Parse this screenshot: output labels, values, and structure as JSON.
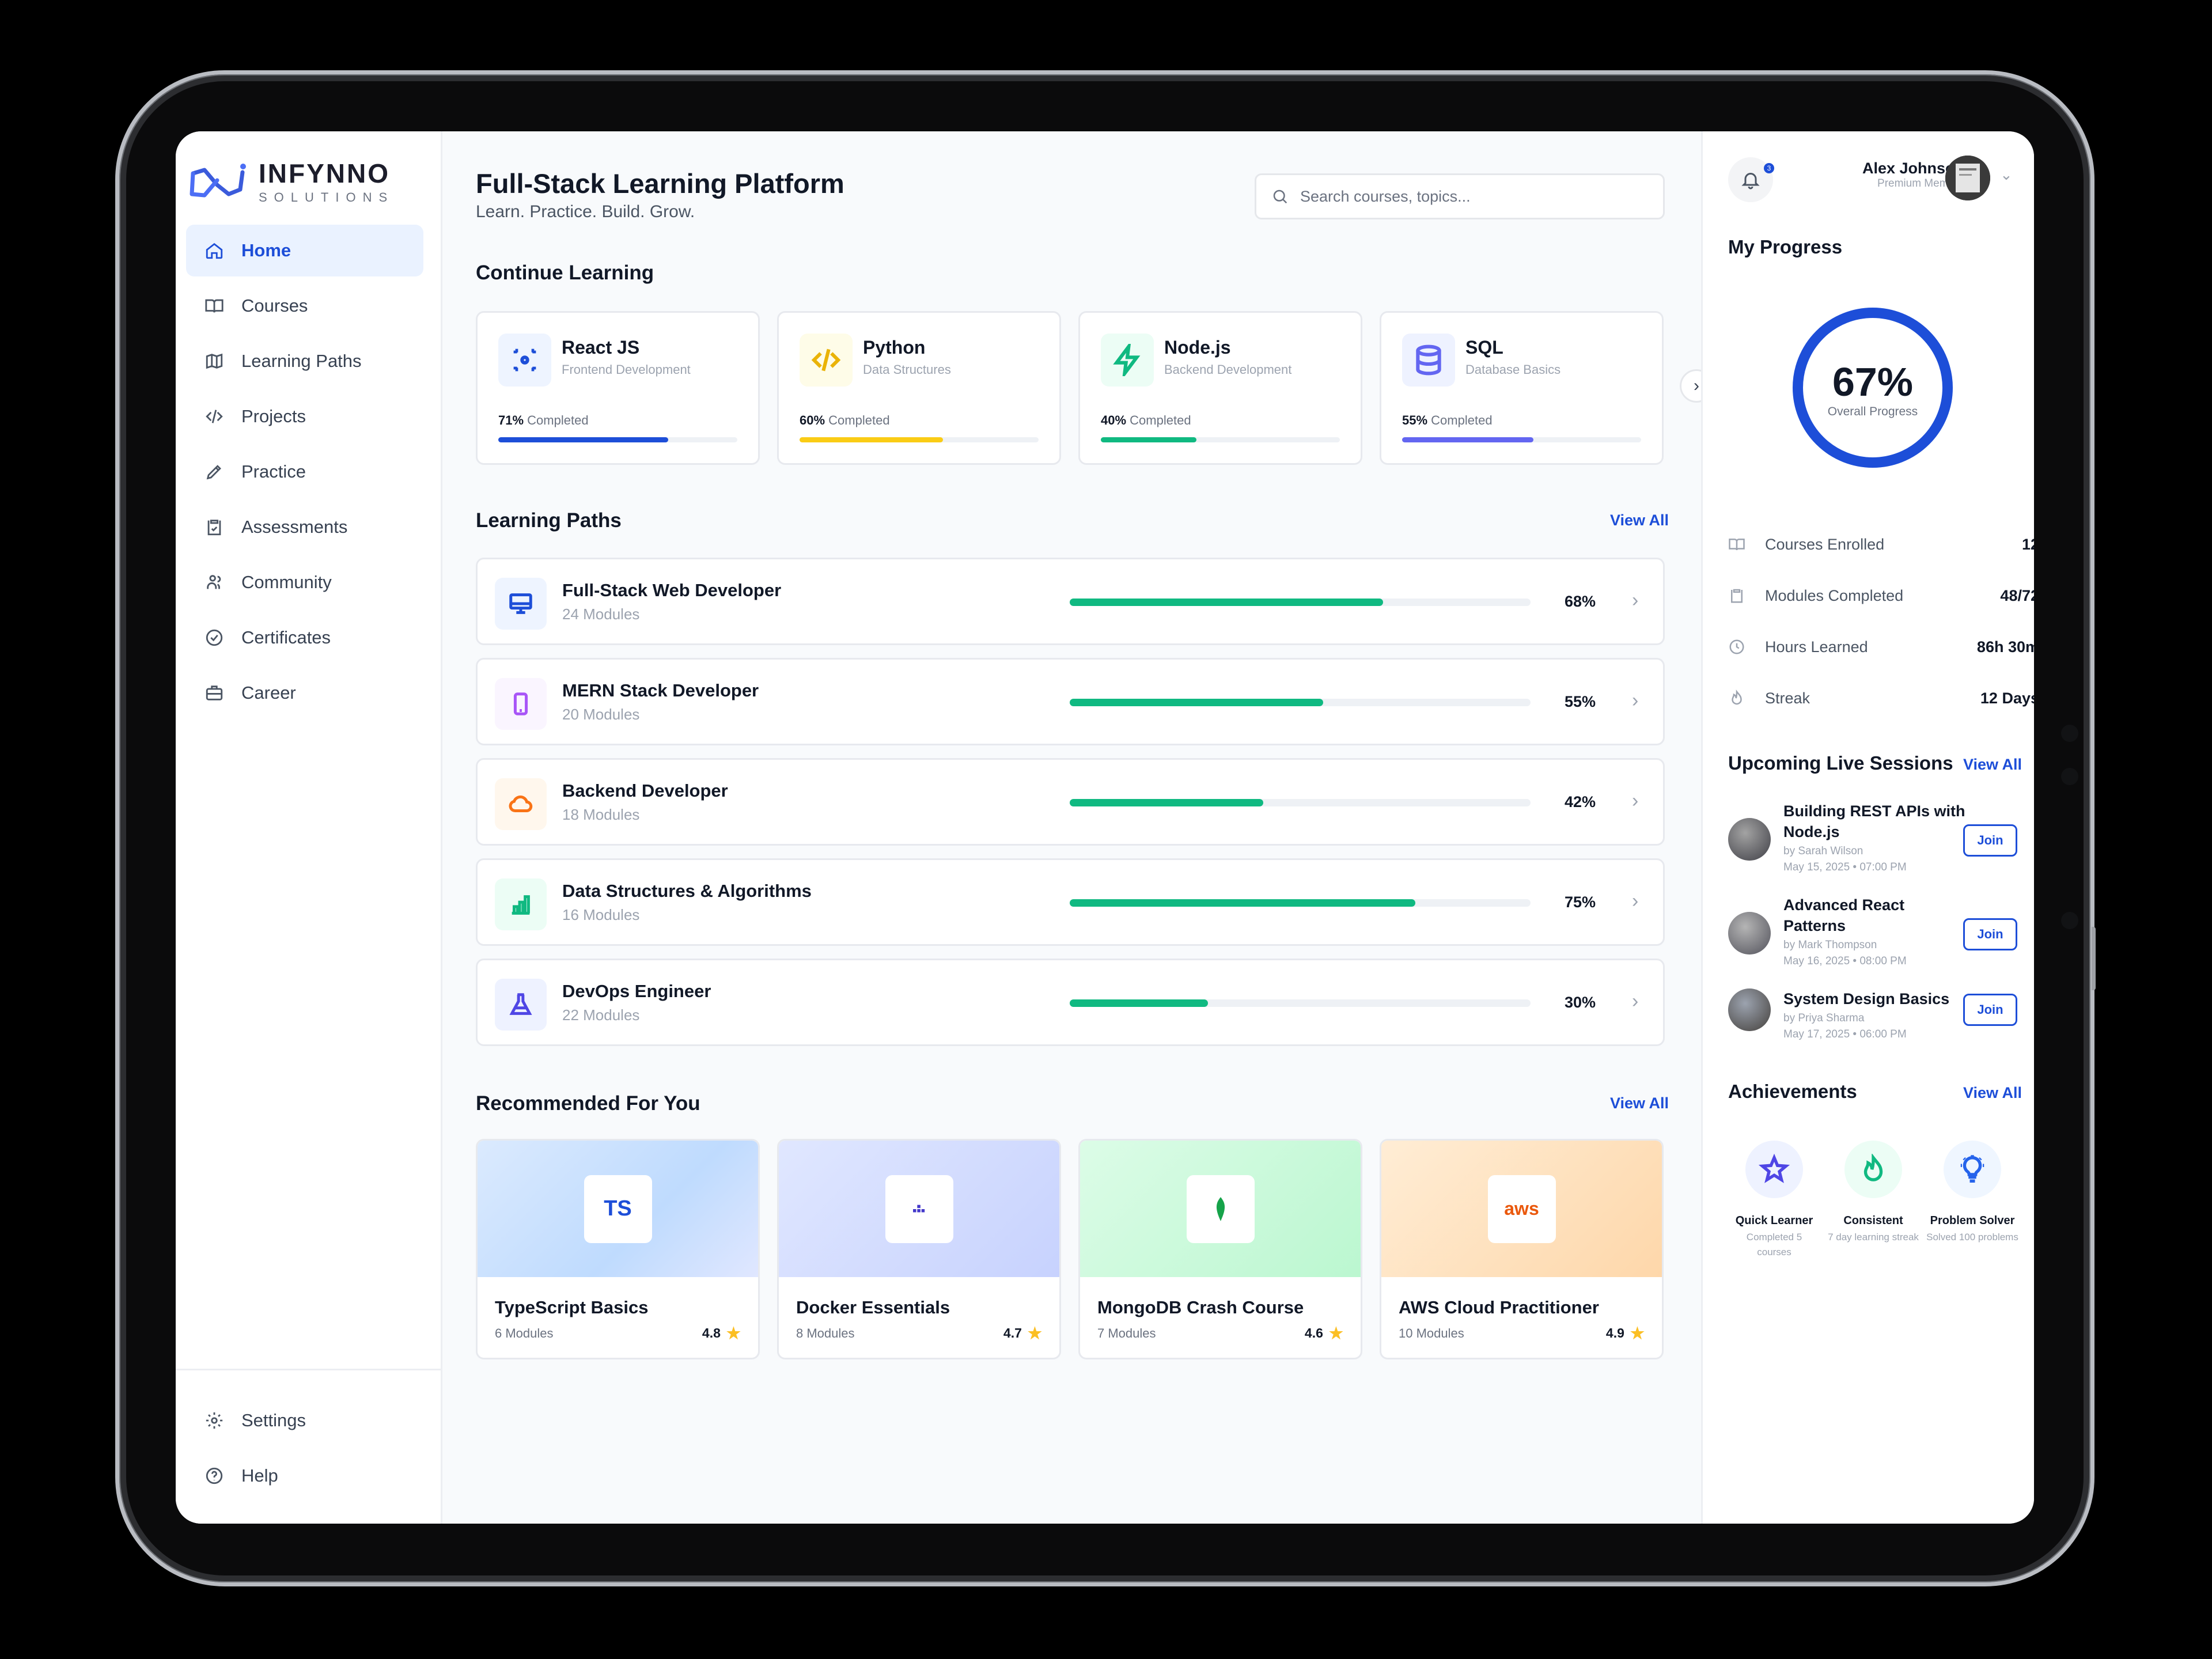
{
  "brand": {
    "name": "INFYNNO",
    "sub": "SOLUTIONS"
  },
  "nav": [
    {
      "label": "Home",
      "icon": "home-icon",
      "active": true
    },
    {
      "label": "Courses",
      "icon": "book-icon"
    },
    {
      "label": "Learning Paths",
      "icon": "map-icon"
    },
    {
      "label": "Projects",
      "icon": "code-icon"
    },
    {
      "label": "Practice",
      "icon": "pencil-icon"
    },
    {
      "label": "Assessments",
      "icon": "clipboard-icon"
    },
    {
      "label": "Community",
      "icon": "community-icon"
    },
    {
      "label": "Certificates",
      "icon": "certificate-icon"
    },
    {
      "label": "Career",
      "icon": "briefcase-icon"
    }
  ],
  "bottom_nav": [
    {
      "label": "Settings",
      "icon": "gear-icon"
    },
    {
      "label": "Help",
      "icon": "help-icon"
    }
  ],
  "header": {
    "title": "Full-Stack Learning Platform",
    "subtitle": "Learn. Practice. Build. Grow.",
    "search_placeholder": "Search courses, topics..."
  },
  "continue": {
    "heading": "Continue Learning",
    "cards": [
      {
        "title": "React JS",
        "subtitle": "Frontend Development",
        "pct_text": "71%",
        "suffix": " Completed",
        "progress": 0.71,
        "color": "#1d4ed8"
      },
      {
        "title": "Python",
        "subtitle": "Data Structures",
        "pct_text": "60%",
        "suffix": " Completed",
        "progress": 0.6,
        "color": "#facc15"
      },
      {
        "title": "Node.js",
        "subtitle": "Backend Development",
        "pct_text": "40%",
        "suffix": " Completed",
        "progress": 0.4,
        "color": "#10b981"
      },
      {
        "title": "SQL",
        "subtitle": "Database Basics",
        "pct_text": "55%",
        "suffix": " Completed",
        "progress": 0.55,
        "color": "#6366f1"
      }
    ]
  },
  "paths": {
    "heading": "Learning Paths",
    "view_all": "View All",
    "items": [
      {
        "title": "Full-Stack Web Developer",
        "modules": "24 Modules",
        "pct": "68%",
        "progress": 0.68
      },
      {
        "title": "MERN Stack Developer",
        "modules": "20 Modules",
        "pct": "55%",
        "progress": 0.55
      },
      {
        "title": "Backend Developer",
        "modules": "18 Modules",
        "pct": "42%",
        "progress": 0.42
      },
      {
        "title": "Data Structures & Algorithms",
        "modules": "16 Modules",
        "pct": "75%",
        "progress": 0.75
      },
      {
        "title": "DevOps Engineer",
        "modules": "22 Modules",
        "pct": "30%",
        "progress": 0.3
      }
    ]
  },
  "recommended": {
    "heading": "Recommended For You",
    "view_all": "View All",
    "items": [
      {
        "title": "TypeScript Basics",
        "modules": "6 Modules",
        "rating": "4.8",
        "logo": "TS"
      },
      {
        "title": "Docker Essentials",
        "modules": "8 Modules",
        "rating": "4.7",
        "logo": ""
      },
      {
        "title": "MongoDB Crash Course",
        "modules": "7 Modules",
        "rating": "4.6",
        "logo": ""
      },
      {
        "title": "AWS Cloud Practitioner",
        "modules": "10 Modules",
        "rating": "4.9",
        "logo": "aws"
      }
    ]
  },
  "user": {
    "name": "Alex Johnson",
    "role": "Premium Member",
    "notifications": "3"
  },
  "progress": {
    "heading": "My Progress",
    "value": "67%",
    "fraction": 0.67,
    "label": "Overall Progress",
    "stats": [
      {
        "label": "Courses Enrolled",
        "value": "12"
      },
      {
        "label": "Modules Completed",
        "value": "48/72"
      },
      {
        "label": "Hours Learned",
        "value": "86h 30m"
      },
      {
        "label": "Streak",
        "value": "12 Days"
      }
    ]
  },
  "sessions": {
    "heading": "Upcoming Live Sessions",
    "view_all": "View All",
    "join": "Join",
    "items": [
      {
        "title": "Building REST APIs with Node.js",
        "by": "by Sarah Wilson",
        "when": "May 15, 2025 • 07:00 PM"
      },
      {
        "title": "Advanced React Patterns",
        "by": "by Mark Thompson",
        "when": "May 16, 2025 • 08:00 PM"
      },
      {
        "title": "System Design Basics",
        "by": "by Priya Sharma",
        "when": "May 17, 2025 • 06:00 PM"
      }
    ]
  },
  "achievements": {
    "heading": "Achievements",
    "view_all": "View All",
    "items": [
      {
        "name": "Quick Learner",
        "desc": "Completed 5 courses"
      },
      {
        "name": "Consistent",
        "desc": "7 day learning streak"
      },
      {
        "name": "Problem Solver",
        "desc": "Solved 100 problems"
      }
    ]
  }
}
